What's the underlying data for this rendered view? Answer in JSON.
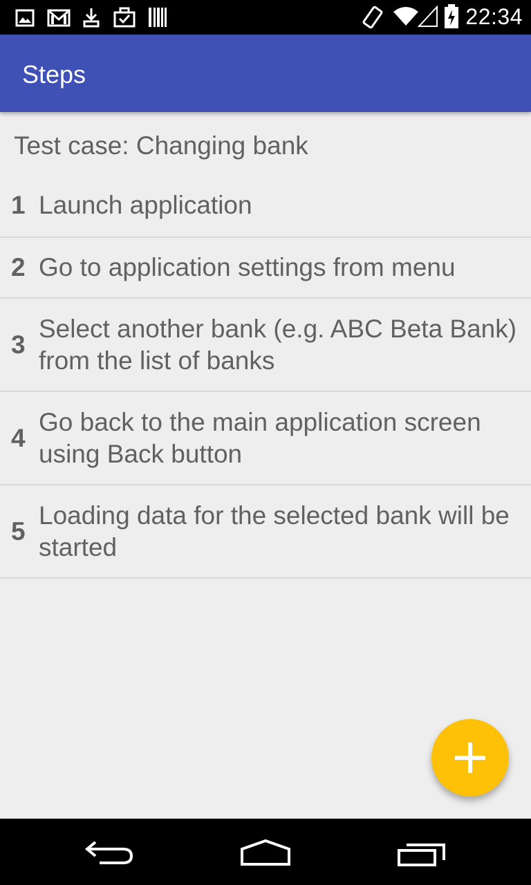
{
  "status_bar": {
    "time": "22:34",
    "left_icons": [
      "image-icon",
      "gmail-icon",
      "download-icon",
      "task-check-icon",
      "barcode-icon"
    ],
    "right_icons": [
      "rotate-icon",
      "wifi-icon",
      "signal-icon",
      "battery-charging-icon"
    ]
  },
  "app_bar": {
    "title": "Steps",
    "color": "#3f51b5"
  },
  "main": {
    "test_case_label": "Test case: Changing bank",
    "steps": [
      {
        "number": "1",
        "text": "Launch application"
      },
      {
        "number": "2",
        "text": "Go to application settings from menu"
      },
      {
        "number": "3",
        "text": "Select another bank (e.g. ABC Beta Bank) from the list of banks"
      },
      {
        "number": "4",
        "text": "Go back to the main application screen using Back button"
      },
      {
        "number": "5",
        "text": "Loading data for the selected bank will be started"
      }
    ]
  },
  "fab": {
    "icon": "plus-icon",
    "color": "#ffc107"
  },
  "nav_bar": {
    "icons": [
      "back-icon",
      "home-icon",
      "recents-icon"
    ]
  }
}
